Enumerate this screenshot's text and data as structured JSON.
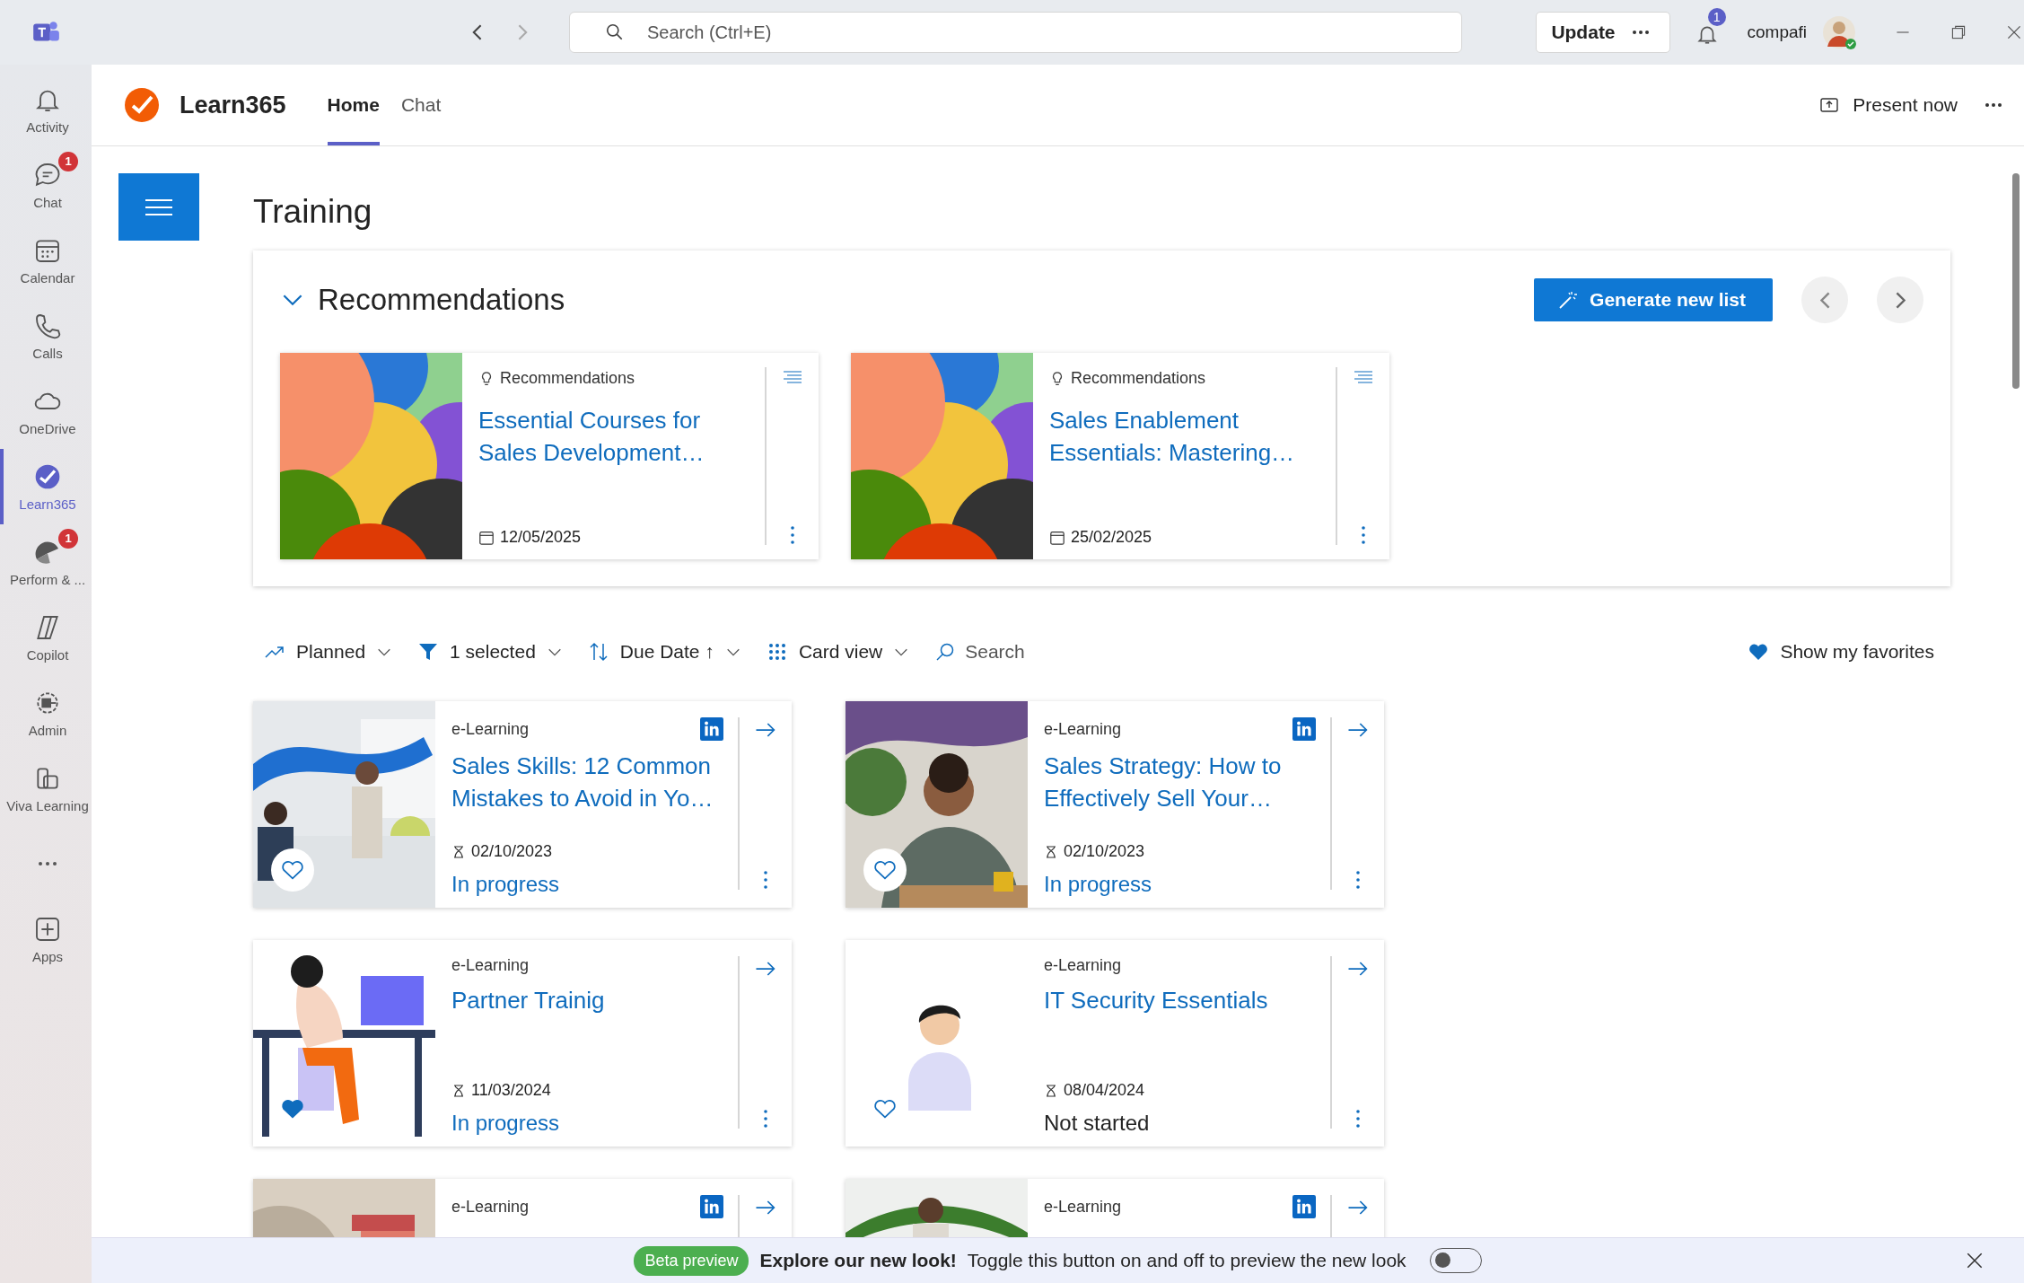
{
  "titlebar": {
    "search_placeholder": "Search (Ctrl+E)",
    "update_button": "Update",
    "notification_count": "1",
    "user": "compafi"
  },
  "rail": [
    {
      "kind": "activity",
      "label": "Activity",
      "selected": false
    },
    {
      "kind": "chat",
      "label": "Chat",
      "selected": false,
      "badge": "1"
    },
    {
      "kind": "calendar",
      "label": "Calendar",
      "selected": false
    },
    {
      "kind": "calls",
      "label": "Calls",
      "selected": false
    },
    {
      "kind": "onedrive",
      "label": "OneDrive",
      "selected": false
    },
    {
      "kind": "learn",
      "label": "Learn365",
      "selected": true
    },
    {
      "kind": "perform",
      "label": "Perform & ...",
      "selected": false,
      "badge": "1"
    },
    {
      "kind": "copilot",
      "label": "Copilot",
      "selected": false
    },
    {
      "kind": "admin",
      "label": "Admin",
      "selected": false
    },
    {
      "kind": "viva",
      "label": "Viva Learning",
      "selected": false
    },
    {
      "kind": "more",
      "selected": false
    },
    {
      "kind": "apps",
      "label": "Apps",
      "selected": false
    }
  ],
  "app": {
    "name": "Learn365",
    "tabs": [
      {
        "label": "Home",
        "selected": true
      },
      {
        "label": "Chat",
        "selected": false
      }
    ],
    "present_button": "Present now"
  },
  "page_title": "Training",
  "recommendations": {
    "title": "Recommendations",
    "expanded": true,
    "generate_button": "Generate new list",
    "cards": [
      {
        "category": "Recommendations",
        "title": "Essential Courses for Sales Development…",
        "date": "12/05/2025"
      },
      {
        "category": "Recommendations",
        "title": "Sales Enablement Essentials: Mastering…",
        "date": "25/02/2025"
      }
    ]
  },
  "toolbar": {
    "items": [
      {
        "kind": "trend",
        "label": "Planned"
      },
      {
        "kind": "filter",
        "label": "1 selected"
      },
      {
        "kind": "sort",
        "label": "Due Date ↑"
      },
      {
        "kind": "grid",
        "label": "Card view"
      }
    ],
    "search_placeholder": "Search",
    "favorites_button": "Show my favorites"
  },
  "courses": [
    {
      "type": "e-Learning",
      "linkedin": true,
      "title": "Sales Skills: 12 Common Mistakes to Avoid in Yo…",
      "date": "02/10/2023",
      "status": "In progress",
      "in_progress": true,
      "favorite": false
    },
    {
      "type": "e-Learning",
      "linkedin": true,
      "title": "Sales Strategy: How to Effectively Sell Your…",
      "date": "02/10/2023",
      "status": "In progress",
      "in_progress": true,
      "favorite": false
    },
    {
      "type": "e-Learning",
      "linkedin": false,
      "title": "Partner Trainig",
      "date": "11/03/2024",
      "status": "In progress",
      "in_progress": true,
      "favorite": true
    },
    {
      "type": "e-Learning",
      "linkedin": false,
      "title": "IT Security Essentials",
      "date": "08/04/2024",
      "status": "Not started",
      "in_progress": false,
      "favorite": false
    },
    {
      "type": "e-Learning",
      "linkedin": true
    },
    {
      "type": "e-Learning",
      "linkedin": true
    }
  ],
  "banner": {
    "badge": "Beta preview",
    "headline": "Explore our new look!",
    "text": "Toggle this button on and off to preview the new look",
    "on": false
  }
}
